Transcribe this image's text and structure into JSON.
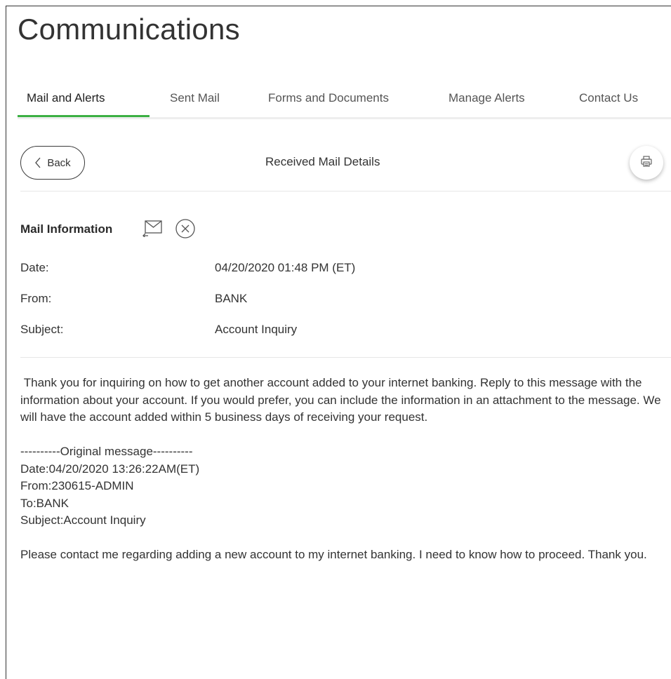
{
  "page": {
    "title": "Communications"
  },
  "tabs": [
    {
      "label": "Mail and Alerts",
      "active": true
    },
    {
      "label": "Sent Mail",
      "active": false
    },
    {
      "label": "Forms and Documents",
      "active": false
    },
    {
      "label": "Manage Alerts",
      "active": false
    },
    {
      "label": "Contact Us",
      "active": false
    }
  ],
  "toolbar": {
    "back_label": "Back",
    "title": "Received Mail Details",
    "print_icon": "printer-icon"
  },
  "mail_info": {
    "section_label": "Mail Information",
    "reply_icon": "reply-envelope-icon",
    "delete_icon": "close-circle-icon",
    "fields": [
      {
        "label": "Date:",
        "value": "04/20/2020 01:48 PM (ET)"
      },
      {
        "label": "From:",
        "value": "BANK"
      },
      {
        "label": "Subject:",
        "value": "Account Inquiry"
      }
    ]
  },
  "message": {
    "reply_body": " Thank you for inquiring on how to get another account added to your internet banking. Reply to this message with the information about your account. If you would prefer, you can include the information in an attachment to the message. We will have the account added within 5 business days of receiving your request.",
    "original_header": "----------Original message----------",
    "original_date": "Date:04/20/2020 13:26:22AM(ET)",
    "original_from": "From:230615-ADMIN",
    "original_to": "To:BANK",
    "original_subject": "Subject:Account Inquiry",
    "original_body": "Please contact me regarding adding a new account to my internet banking. I need to know how to proceed. Thank you."
  },
  "colors": {
    "accent": "#3cb043",
    "text": "#333333",
    "divider": "#e6e6e6"
  }
}
